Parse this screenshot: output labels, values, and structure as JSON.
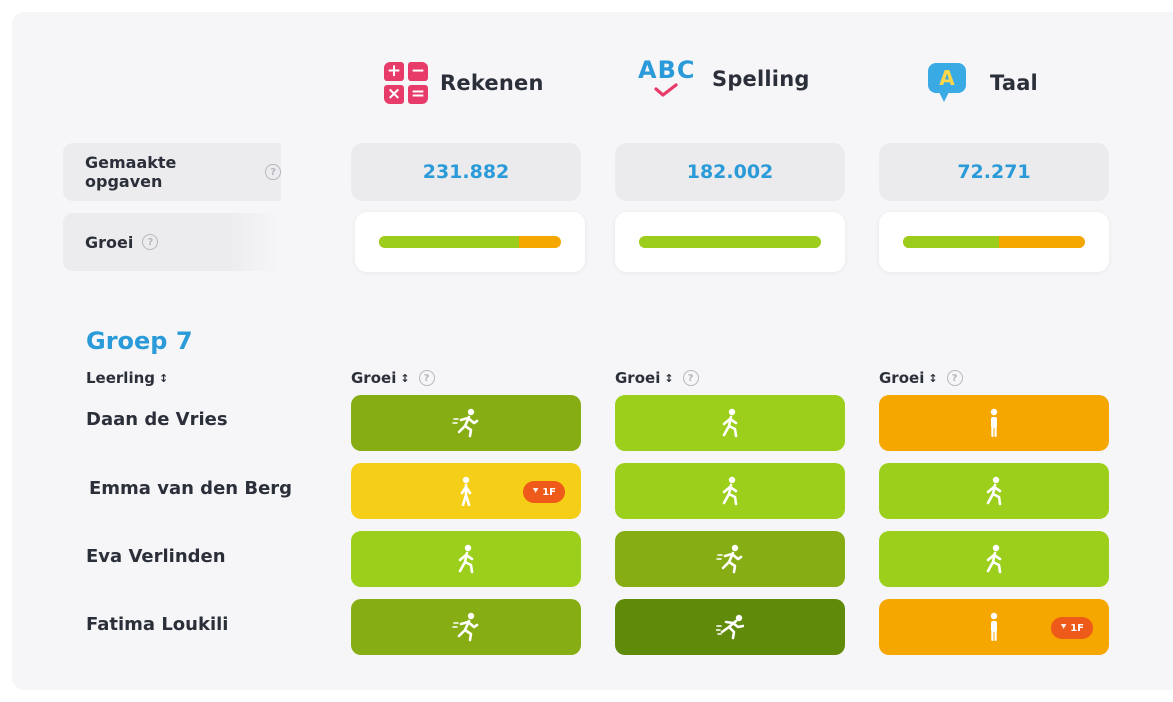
{
  "colors": {
    "accent": "#2a9bd8",
    "green_dark": "#5f8a0a",
    "green_mid": "#86ad14",
    "green_light": "#9ccf1c",
    "yellow": "#f5cf17",
    "orange": "#f5a700",
    "badge": "#ee5a1a"
  },
  "subjects": [
    {
      "label": "Rekenen",
      "icon": "rekenen-icon"
    },
    {
      "label": "Spelling",
      "icon": "abc-check-icon",
      "icon_text": "ABC"
    },
    {
      "label": "Taal",
      "icon": "speech-bubble-icon",
      "icon_text": "A"
    }
  ],
  "stats": {
    "made_label": "Gemaakte opgaven",
    "growth_label": "Groei",
    "made_values": [
      "231.882",
      "182.002",
      "72.271"
    ],
    "growth_green_fraction": [
      0.77,
      1.0,
      0.53
    ]
  },
  "rekenen_ops": [
    "+",
    "−",
    "×",
    "="
  ],
  "group": {
    "title": "Groep 7",
    "student_col": "Leerling",
    "growth_col": "Groei",
    "sort_icon": "↕"
  },
  "help_glyph": "?",
  "students": [
    {
      "name": "Daan de Vries",
      "cells": [
        {
          "level": "green_mid",
          "icon": "running-icon"
        },
        {
          "level": "green_light",
          "icon": "walking-icon"
        },
        {
          "level": "orange",
          "icon": "standing-icon"
        }
      ]
    },
    {
      "name": "Emma van den Berg",
      "cells": [
        {
          "level": "yellow",
          "icon": "slow-walking-icon",
          "badge": "1F"
        },
        {
          "level": "green_light",
          "icon": "walking-icon"
        },
        {
          "level": "green_light",
          "icon": "walking-icon"
        }
      ]
    },
    {
      "name": "Eva Verlinden",
      "cells": [
        {
          "level": "green_light",
          "icon": "walking-icon"
        },
        {
          "level": "green_mid",
          "icon": "running-icon"
        },
        {
          "level": "green_light",
          "icon": "walking-icon"
        }
      ]
    },
    {
      "name": "Fatima Loukili",
      "cells": [
        {
          "level": "green_mid",
          "icon": "running-icon"
        },
        {
          "level": "green_dark",
          "icon": "sprinting-icon"
        },
        {
          "level": "orange",
          "icon": "standing-icon",
          "badge": "1F"
        }
      ]
    }
  ]
}
